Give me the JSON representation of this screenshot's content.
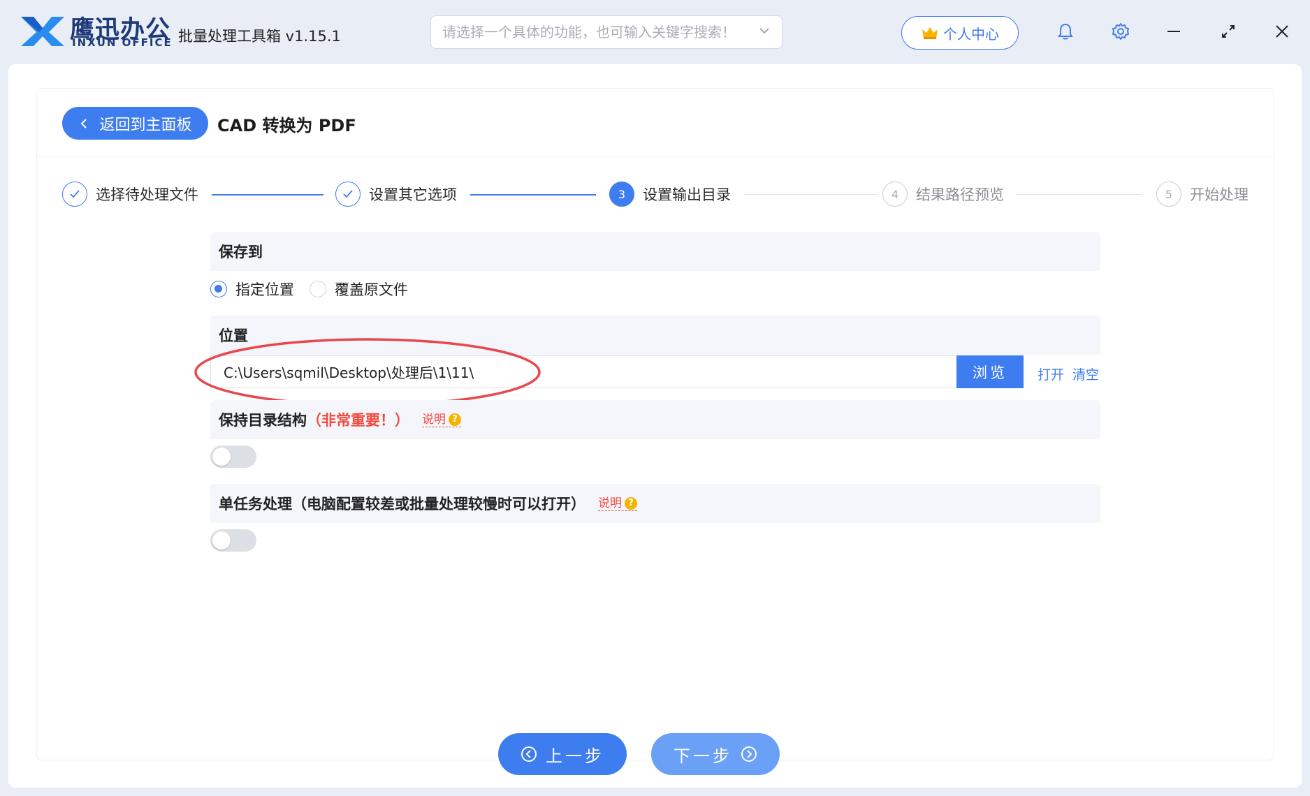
{
  "app": {
    "brand_cn": "鹰迅办公",
    "brand_en": "INXUN OFFICE",
    "title": "批量处理工具箱 v1.15.1"
  },
  "search": {
    "placeholder": "请选择一个具体的功能，也可输入关键字搜索！"
  },
  "header": {
    "user_center": "个人中心"
  },
  "page": {
    "back_label": "返回到主面板",
    "title": "CAD 转换为 PDF"
  },
  "steps": [
    {
      "num": "1",
      "label": "选择待处理文件",
      "state": "done"
    },
    {
      "num": "2",
      "label": "设置其它选项",
      "state": "done"
    },
    {
      "num": "3",
      "label": "设置输出目录",
      "state": "active"
    },
    {
      "num": "4",
      "label": "结果路径预览",
      "state": "future"
    },
    {
      "num": "5",
      "label": "开始处理",
      "state": "future"
    }
  ],
  "save_to": {
    "heading": "保存到",
    "options": [
      "指定位置",
      "覆盖原文件"
    ],
    "selected": "指定位置"
  },
  "location": {
    "heading": "位置",
    "path": "C:\\Users\\sqmil\\Desktop\\处理后\\1\\11\\",
    "browse": "浏览",
    "open": "打开",
    "clear": "清空"
  },
  "keep_structure": {
    "heading": "保持目录结构",
    "note": "（非常重要！）",
    "explain": "说明",
    "enabled": false
  },
  "single_task": {
    "heading": "单任务处理（电脑配置较差或批量处理较慢时可以打开）",
    "explain": "说明",
    "enabled": false
  },
  "nav": {
    "prev": "上一步",
    "next": "下一步"
  },
  "colors": {
    "accent": "#3e7df0",
    "warning": "#f24a3c",
    "highlight_ring": "#e8474c"
  }
}
